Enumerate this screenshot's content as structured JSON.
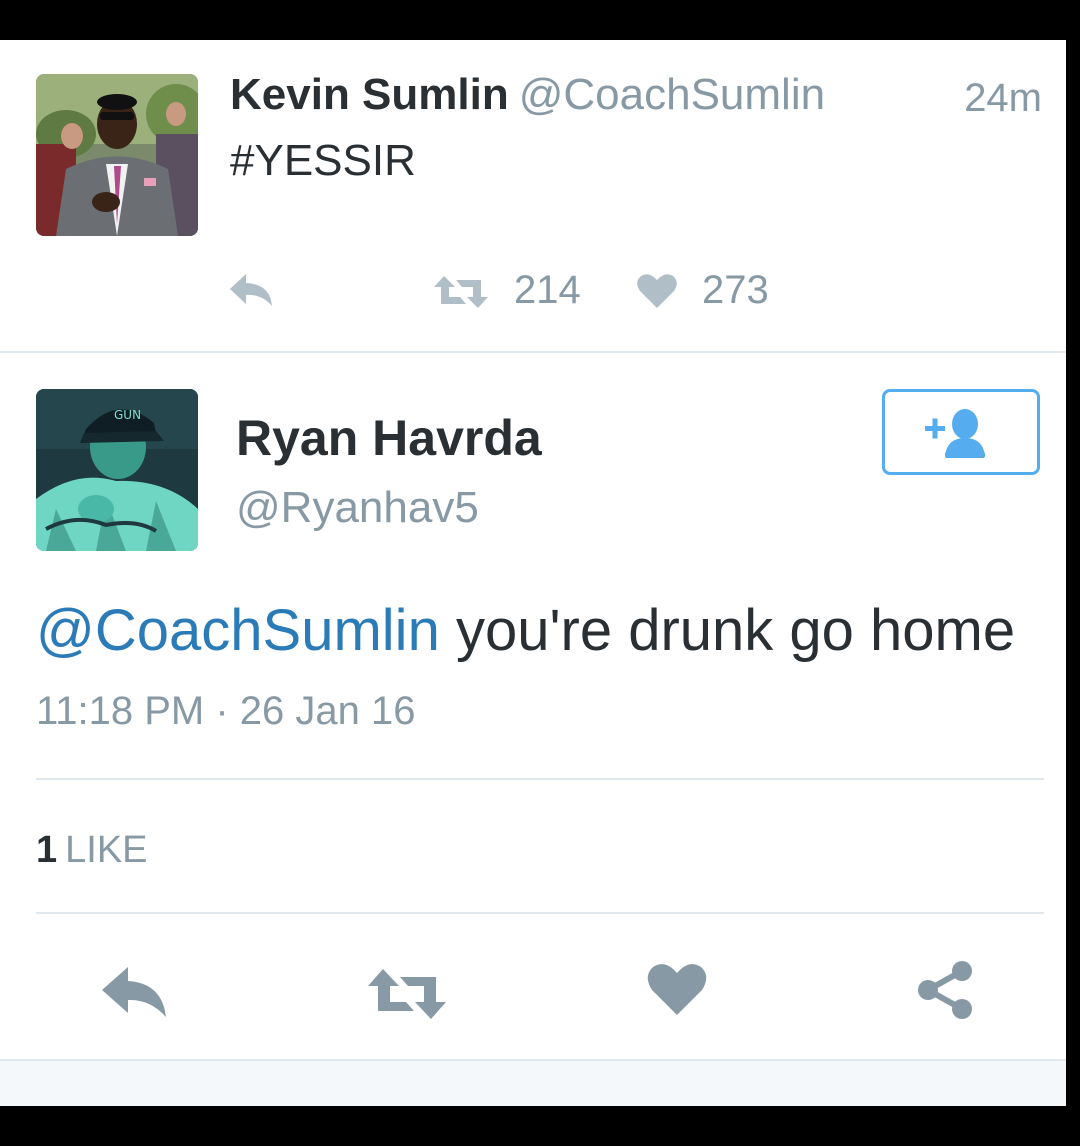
{
  "timeline_tweet": {
    "author_name": "Kevin Sumlin",
    "author_handle": "@CoachSumlin",
    "time_ago": "24m",
    "text": "#YESSIR",
    "retweet_count": "214",
    "like_count": "273",
    "icons": [
      "reply-icon",
      "retweet-icon",
      "heart-icon"
    ]
  },
  "detail_tweet": {
    "author_name": "Ryan Havrda",
    "author_handle": "@Ryanhav5",
    "mention": "@CoachSumlin",
    "text": " you're drunk go home",
    "timestamp": "11:18 PM · 26 Jan 16",
    "likes_count": "1",
    "likes_label": "LIKE",
    "follow_icon": "follow-user-icon",
    "action_icons": [
      "reply-icon",
      "retweet-icon",
      "heart-icon",
      "share-icon"
    ]
  },
  "colors": {
    "accent": "#55acee",
    "mention": "#2b7bb9",
    "muted": "#8899a6",
    "text": "#292f33",
    "divider": "#e1e8ed",
    "icon": "#8899a6"
  }
}
